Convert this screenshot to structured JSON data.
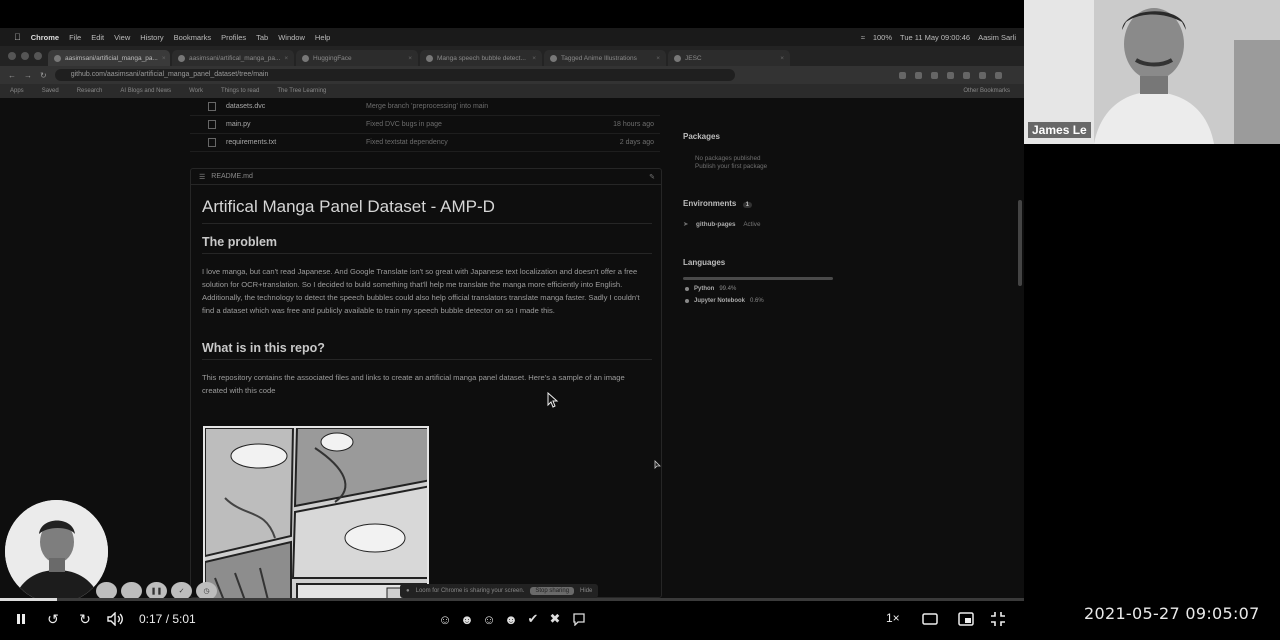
{
  "browser": {
    "menubar": {
      "app": "Chrome",
      "items": [
        "File",
        "Edit",
        "View",
        "History",
        "Bookmarks",
        "Profiles",
        "Tab",
        "Window",
        "Help"
      ],
      "battery": "100%",
      "clock": "Tue 11 May  09:00:46",
      "user": "Aasim Sarli"
    },
    "tabs": [
      {
        "label": "aasimsani/artificial_manga_pa..."
      },
      {
        "label": "aasimsani/artifical_manga_pa..."
      },
      {
        "label": "HuggingFace"
      },
      {
        "label": "Manga speech bubble detect..."
      },
      {
        "label": "Tagged Anime Illustrations"
      },
      {
        "label": "JESC"
      }
    ],
    "url": "github.com/aasimsani/artificial_manga_panel_dataset/tree/main",
    "bookmarks": [
      "Apps",
      "Saved",
      "Research",
      "AI Blogs and News",
      "Work",
      "Things to read",
      "The Tree Learning"
    ],
    "other_bookmarks": "Other Bookmarks"
  },
  "repo": {
    "files": [
      {
        "name": "datasets.dvc",
        "message": "Merge branch 'preprocessing' into main",
        "age": ""
      },
      {
        "name": "main.py",
        "message": "Fixed DVC bugs in page",
        "age": "18 hours ago"
      },
      {
        "name": "requirements.txt",
        "message": "Fixed textstat dependency",
        "age": "2 days ago"
      }
    ],
    "readme_file": "README.md",
    "readme_title": "Artifical Manga Panel Dataset - AMP-D",
    "h2_problem": "The problem",
    "problem_text": "I love manga, but can't read Japanese. And Google Translate isn't so great with Japanese text localization and doesn't offer a free solution for OCR+translation. So I decided to build something that'll help me translate the manga more efficiently into English. Additionally, the technology to detect the speech bubbles could also help official translators translate manga faster. Sadly I couldn't find a dataset which was free and publicly available to train my speech bubble detector on so I made this.",
    "h2_repo": "What is in this repo?",
    "repo_text": "This repository contains the associated files and links to create an artificial manga panel dataset. Here's a sample of an image created with this code"
  },
  "sidebar": {
    "packages_title": "Packages",
    "packages_text": [
      "No packages published",
      "Publish your first package"
    ],
    "environments_title": "Environments",
    "environments_count": "1",
    "env_name": "github-pages",
    "env_status": "Active",
    "languages_title": "Languages",
    "languages": [
      {
        "name": "Python",
        "percent": "99.4%"
      },
      {
        "name": "Jupyter Notebook",
        "percent": "0.6%"
      }
    ]
  },
  "share_banner": {
    "text": "Loom for Chrome is sharing your screen.",
    "stop": "Stop sharing",
    "hide": "Hide"
  },
  "speaker": {
    "name": "James Le"
  },
  "player": {
    "current": "0:17",
    "total": "5:01",
    "time_display": "0:17 / 5:01",
    "progress_fraction": 0.056,
    "speed": "1×"
  },
  "timestamp": "2021-05-27  09:05:07",
  "colors": {
    "background": "#000000",
    "screen": "#0e0e0e",
    "text": "#d6d6d6"
  }
}
